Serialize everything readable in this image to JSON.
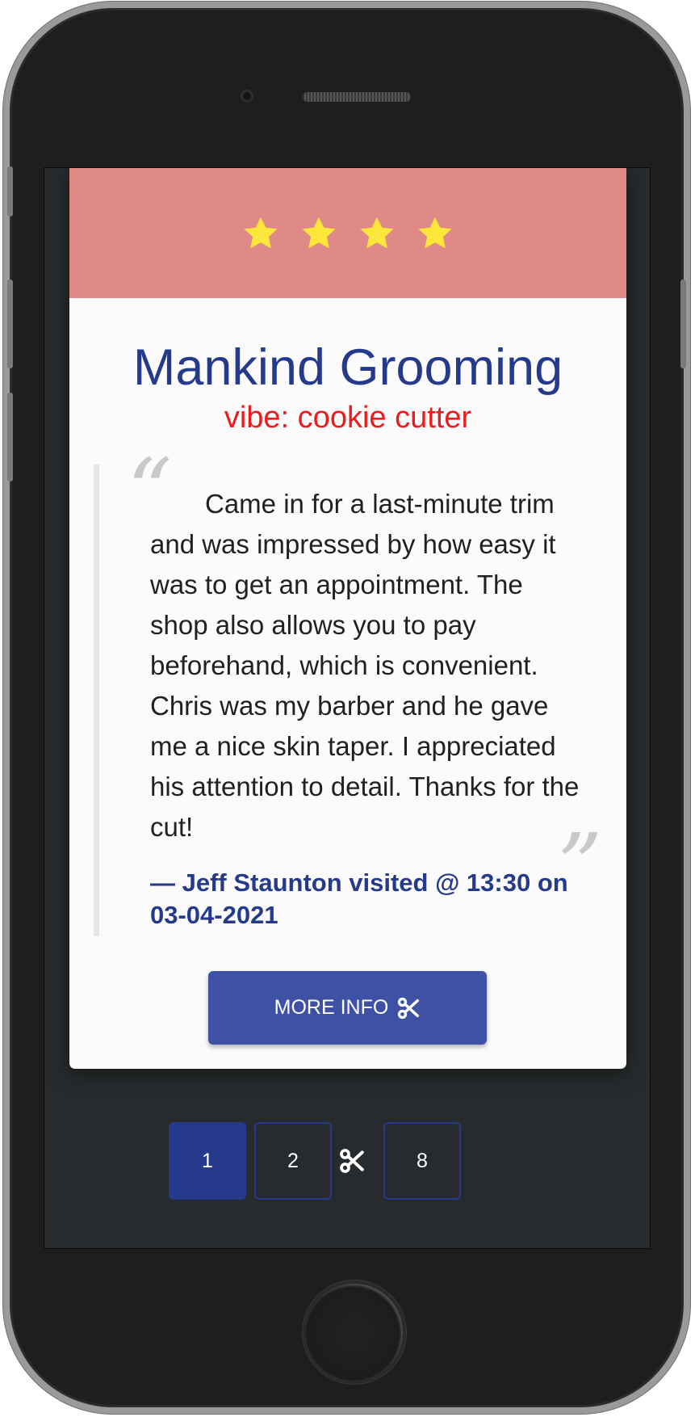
{
  "review": {
    "rating_stars": 4,
    "shop_name": "Mankind Grooming",
    "vibe": "vibe: cookie cutter",
    "text": "Came in for a last-minute trim and was impressed by how easy it was to get an appointment. The shop also allows you to pay beforehand, which is convenient. Chris was my barber and he gave me a nice skin taper. I appreciated his attention to detail. Thanks for the cut!",
    "attribution": "— Jeff Staunton visited @ 13:30 on 03-04-2021",
    "quote_open": "“",
    "quote_close": "”"
  },
  "actions": {
    "more_info_label": "MORE INFO",
    "more_info_icon": "scissors-icon"
  },
  "pagination": {
    "pages": [
      "1",
      "2",
      "8"
    ],
    "active_page": "1",
    "separator_icon": "scissors-icon"
  },
  "colors": {
    "header_bg": "#e08a88",
    "title": "#263a8c",
    "vibe": "#ec1c1c",
    "star": "#fde73a",
    "button": "#3f51a4",
    "page_active": "#263a8c"
  }
}
